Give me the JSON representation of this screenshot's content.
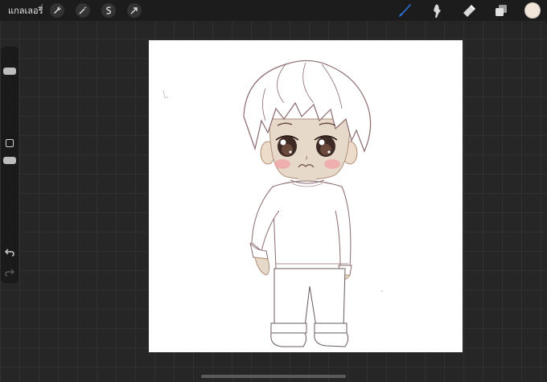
{
  "topbar": {
    "gallery_label": "แกลเลอรี่",
    "tools_left": [
      "wrench-icon",
      "magic-wand-icon",
      "selection-icon",
      "transform-arrow-icon"
    ],
    "tools_right": [
      "brush-icon",
      "smudge-icon",
      "eraser-icon",
      "layers-icon"
    ],
    "current_color": "#f1e4d8",
    "brush_color": "#2f7bf6"
  },
  "sidebar": {
    "brush_size": 0.75,
    "opacity": 0.1
  },
  "canvas": {
    "background": "#ffffff",
    "artwork": "chibi-boy-drawing"
  }
}
